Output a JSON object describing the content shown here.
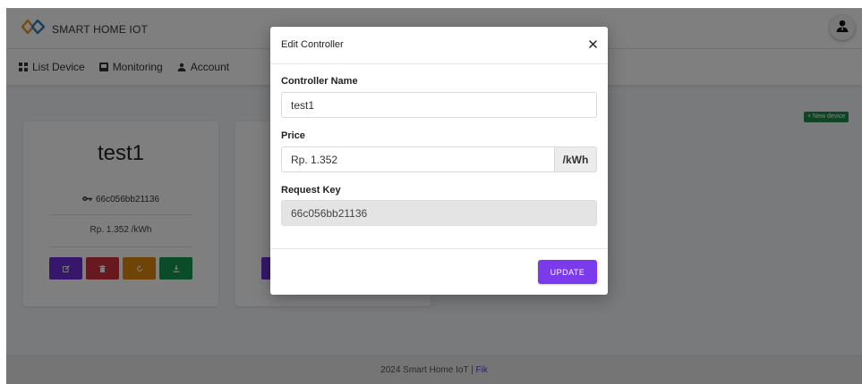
{
  "app": {
    "brand_name": "SMART HOME IOT",
    "colors": {
      "primary": "#7c3aed",
      "danger": "#d0303e",
      "warning": "#e0870c",
      "success": "#14994e",
      "overlay": "rgba(0,0,0,0.5)"
    }
  },
  "nav": {
    "items": [
      {
        "label": "List Device",
        "icon": "grid-icon"
      },
      {
        "label": "Monitoring",
        "icon": "monitor-icon"
      },
      {
        "label": "Account",
        "icon": "user-icon"
      }
    ]
  },
  "header": {
    "user_icon": "user-avatar-icon"
  },
  "new_device_label": "+ New device",
  "devices": [
    {
      "name": "test1",
      "key": "66c056bb21136",
      "price": "Rp. 1.352 /kWh",
      "actions": [
        "edit-icon",
        "trash-icon",
        "refresh-icon",
        "download-icon"
      ]
    }
  ],
  "modal": {
    "title": "Edit Controller",
    "close_symbol": "×",
    "fields": {
      "name_label": "Controller Name",
      "name_value": "test1",
      "price_label": "Price",
      "price_value": "Rp. 1.352",
      "price_unit": "/kWh",
      "key_label": "Request Key",
      "key_value": "66c056bb21136"
    },
    "submit_label": "UPDATE"
  },
  "footer": {
    "text": "2024 Smart Home IoT | ",
    "link": "Fik"
  }
}
